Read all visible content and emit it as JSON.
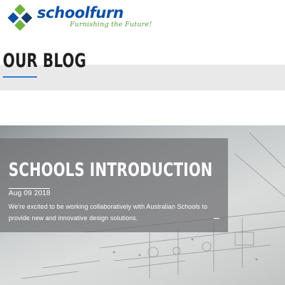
{
  "brand": {
    "name_part1": "school",
    "name_part2": "furn",
    "tagline": "Furnishing the Future!",
    "colors": {
      "blue": "#0d4fa3",
      "green": "#5a9b3e",
      "dark": "#143d6b"
    }
  },
  "page": {
    "title": "OUR BLOG",
    "accent_color": "#2f7fd1"
  },
  "post": {
    "title": "SCHOOLS INTRODUCTION",
    "date": "Aug 09 2018",
    "excerpt": "We're excited to be working collaboratively with Australian Schools to provide new and innovative design solutions.",
    "more_icon": "dash-icon"
  }
}
